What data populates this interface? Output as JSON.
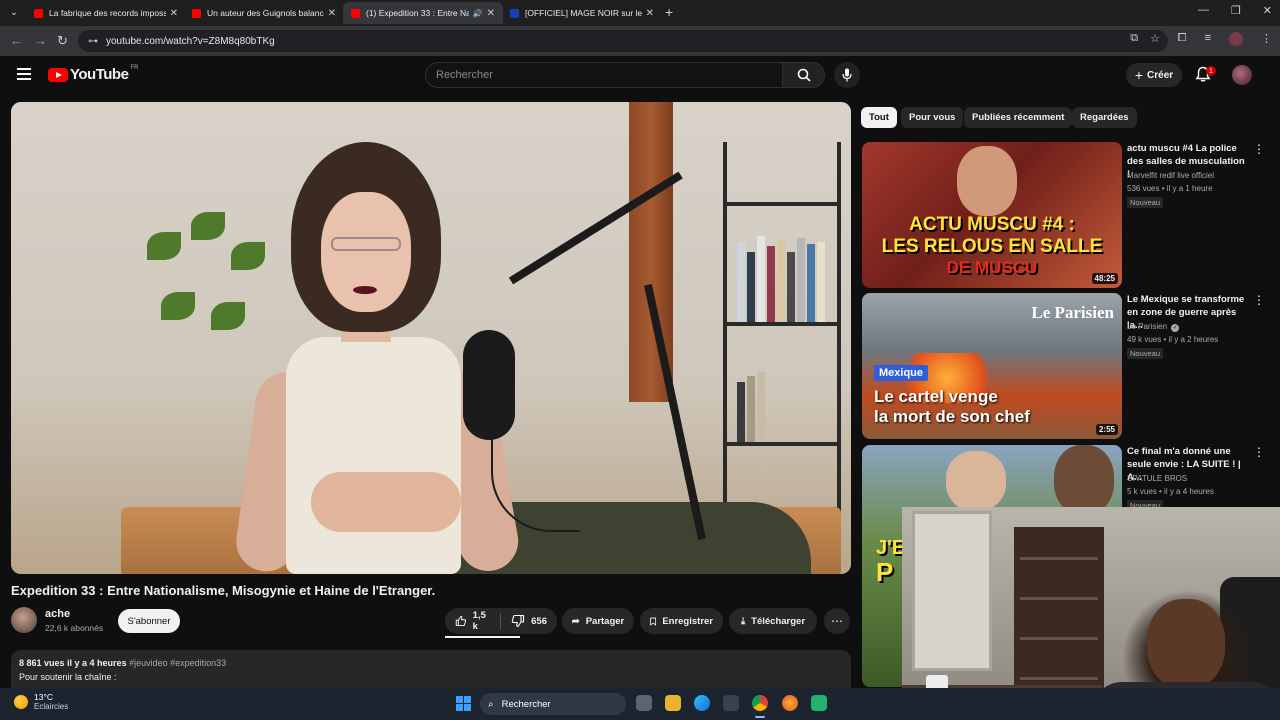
{
  "browser": {
    "tabs": [
      {
        "title": "La fabrique des records imposs",
        "active": false
      },
      {
        "title": "Un auteur des Guignols balanc",
        "active": false
      },
      {
        "title": "(1) Expedition 33 : Entre Na",
        "active": true
      },
      {
        "title": "[OFFICIEL] MAGE NOIR sur le fil",
        "active": false
      }
    ],
    "url": "youtube.com/watch?v=Z8M8q80bTKg"
  },
  "youtube": {
    "logo_text": "YouTube",
    "country_code": "FR",
    "search_placeholder": "Rechercher",
    "create_label": "Créer",
    "notification_count": "1"
  },
  "video": {
    "title": "Expedition 33 : Entre Nationalisme, Misogynie et Haine de l'Etranger.",
    "channel": "ache",
    "subscribers": "22,6 k abonnés",
    "subscribe_label": "S'abonner",
    "likes": "1,5 k",
    "dislikes": "656",
    "share_label": "Partager",
    "save_label": "Enregistrer",
    "download_label": "Télécharger",
    "views_date": "8 861 vues  il y a 4 heures",
    "hashtags": "#jeuvideo #expedition33",
    "description_line": "Pour soutenir la chaîne :"
  },
  "sidebar": {
    "chips": [
      "Tout",
      "Pour vous",
      "Publiées récemment",
      "Regardées"
    ],
    "recommendations": [
      {
        "title": "actu muscu #4 La police des salles de musculation !",
        "channel": "Marvelfit redif live officiel",
        "stats": "536 vues • il y a 1 heure",
        "badge": "Nouveau",
        "duration": "48:25",
        "thumb_text": [
          "ACTU MUSCU #4 :",
          "LES RELOUS EN SALLE",
          "DE MUSCU"
        ]
      },
      {
        "title": "Le Mexique se transforme en zone de guerre après la...",
        "channel": "Le Parisien",
        "verified": true,
        "stats": "49 k vues • il y a 2 heures",
        "badge": "Nouveau",
        "duration": "2:55",
        "thumb_brand": "Le Parisien",
        "thumb_tag": "Mexique",
        "thumb_text": [
          "Le cartel venge",
          "la mort de son chef"
        ]
      },
      {
        "title": "Ce final m'a donné une seule envie : LA SUITE ! | A...",
        "channel": "SPATULE BROS",
        "stats": "5 k vues • il y a 4 heures",
        "badge": "Nouveau",
        "thumb_text": [
          "J'E",
          "P"
        ]
      }
    ]
  },
  "taskbar": {
    "temperature": "13°C",
    "condition": "Eclaircies",
    "search_label": "Rechercher"
  },
  "colors": {
    "yt_red": "#ff0000",
    "background": "#0f0f0f",
    "pill": "#272727",
    "text": "#f1f1f1",
    "secondary_text": "#aaaaaa"
  }
}
